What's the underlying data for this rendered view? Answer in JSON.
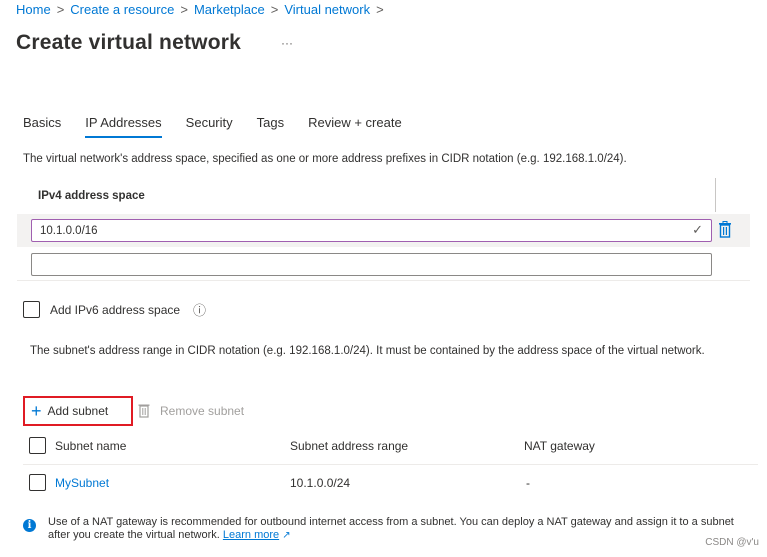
{
  "breadcrumb": [
    {
      "label": "Home"
    },
    {
      "label": "Create a resource"
    },
    {
      "label": "Marketplace"
    },
    {
      "label": "Virtual network"
    }
  ],
  "breadcrumb_separator": ">",
  "page": {
    "title": "Create virtual network",
    "more_label": "···"
  },
  "tabs": [
    {
      "label": "Basics",
      "active": false
    },
    {
      "label": "IP Addresses",
      "active": true
    },
    {
      "label": "Security",
      "active": false
    },
    {
      "label": "Tags",
      "active": false
    },
    {
      "label": "Review + create",
      "active": false
    }
  ],
  "address_space": {
    "description": "The virtual network's address space, specified as one or more address prefixes in CIDR notation (e.g. 192.168.1.0/24).",
    "column_header": "IPv4 address space",
    "rows": [
      {
        "value": "10.1.0.0/16",
        "valid": true
      },
      {
        "value": "",
        "valid": false
      }
    ],
    "valid_icon": "✓"
  },
  "ipv6": {
    "label": "Add IPv6 address space",
    "checked": false,
    "info_icon": "ⓘ"
  },
  "subnet_section": {
    "description": "The subnet's address range in CIDR notation (e.g. 192.168.1.0/24). It must be contained by the address space of the virtual network.",
    "add_label": "Add subnet",
    "remove_label": "Remove subnet",
    "columns": [
      "Subnet name",
      "Subnet address range",
      "NAT gateway"
    ],
    "rows": [
      {
        "name": "MySubnet",
        "range": "10.1.0.0/24",
        "nat": "-"
      }
    ]
  },
  "info_bar": {
    "text": "Use of a NAT gateway is recommended for outbound internet access from a subnet. You can deploy a NAT gateway and assign it to a subnet after you create the virtual network.",
    "link_label": "Learn more",
    "icon": "i"
  },
  "watermark": "CSDN @v'u",
  "colors": {
    "accent": "#0078d4",
    "valid_border": "#a05fb0",
    "highlight_box": "#e01b24"
  }
}
